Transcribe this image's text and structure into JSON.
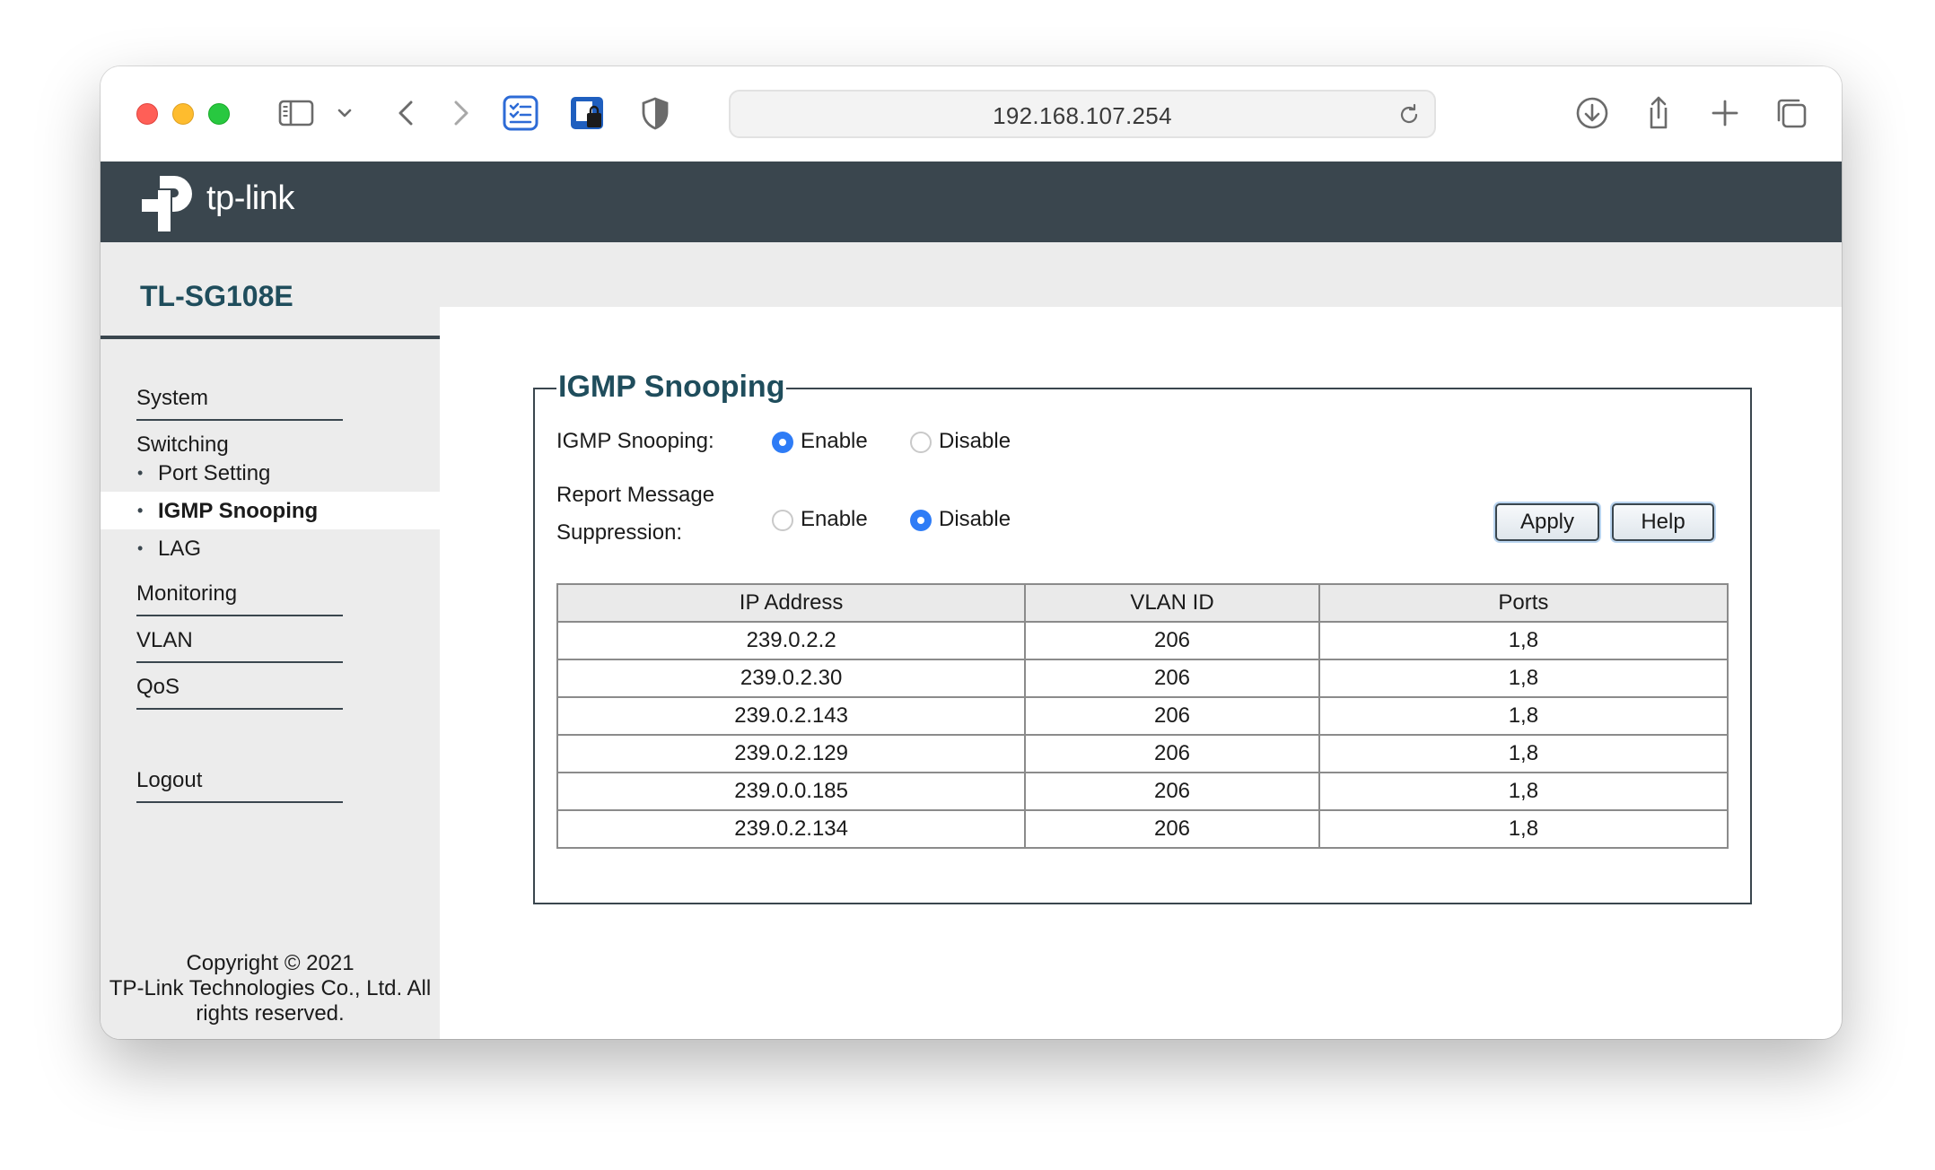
{
  "browser": {
    "address": "192.168.107.254"
  },
  "brand": {
    "name": "tp-link"
  },
  "sidebar": {
    "model": "TL-SG108E",
    "items": {
      "system": "System",
      "switching": "Switching",
      "port_setting": "Port Setting",
      "igmp_snooping": "IGMP Snooping",
      "lag": "LAG",
      "monitoring": "Monitoring",
      "vlan": "VLAN",
      "qos": "QoS",
      "logout": "Logout"
    },
    "copyright": {
      "line1": "Copyright © 2021",
      "line2": "TP-Link Technologies Co., Ltd. All",
      "line3": "rights reserved."
    }
  },
  "panel": {
    "title": "IGMP Snooping",
    "igmp_label": "IGMP Snooping:",
    "report_label_line1": "Report Message",
    "report_label_line2": "Suppression:",
    "enable": "Enable",
    "disable": "Disable",
    "igmp_state": "enable",
    "report_state": "disable",
    "apply": "Apply",
    "help": "Help"
  },
  "table": {
    "headers": [
      "IP Address",
      "VLAN ID",
      "Ports"
    ],
    "rows": [
      [
        "239.0.2.2",
        "206",
        "1,8"
      ],
      [
        "239.0.2.30",
        "206",
        "1,8"
      ],
      [
        "239.0.2.143",
        "206",
        "1,8"
      ],
      [
        "239.0.2.129",
        "206",
        "1,8"
      ],
      [
        "239.0.0.185",
        "206",
        "1,8"
      ],
      [
        "239.0.2.134",
        "206",
        "1,8"
      ]
    ]
  },
  "colors": {
    "brand_bar": "#3a464e",
    "title_teal": "#1f4d5c",
    "radio_selected": "#2e7cf6"
  }
}
